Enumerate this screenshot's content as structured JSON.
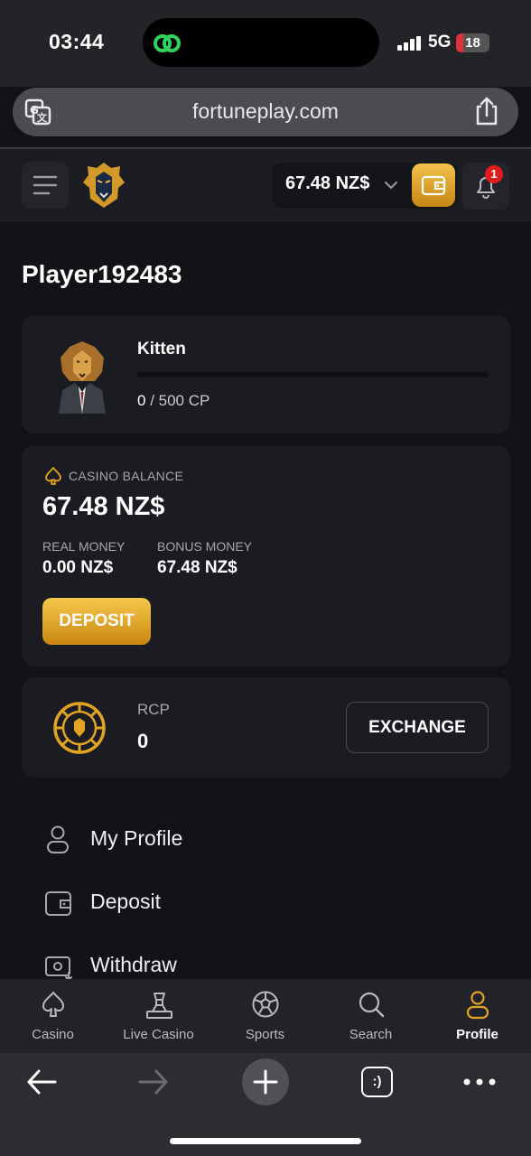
{
  "status_bar": {
    "time": "03:44",
    "network": "5G",
    "battery": "18"
  },
  "browser": {
    "url": "fortuneplay.com"
  },
  "header": {
    "balance": "67.48 NZ$",
    "notification_count": "1"
  },
  "profile": {
    "username": "Player192483",
    "level": {
      "name": "Kitten",
      "current_cp": "0",
      "progress_text": " / 500 CP"
    },
    "casino_balance": {
      "heading": "CASINO BALANCE",
      "amount": "67.48 NZ$",
      "real_money_label": "REAL MONEY",
      "real_money_value": "0.00 NZ$",
      "bonus_money_label": "BONUS MONEY",
      "bonus_money_value": "67.48 NZ$",
      "deposit_label": "DEPOSIT"
    },
    "rcp": {
      "label": "RCP",
      "value": "0",
      "exchange_label": "EXCHANGE"
    }
  },
  "menu": [
    {
      "label": "My Profile",
      "icon": "user-icon"
    },
    {
      "label": "Deposit",
      "icon": "wallet-icon"
    },
    {
      "label": "Withdraw",
      "icon": "withdraw-icon"
    }
  ],
  "bottom_nav": [
    {
      "label": "Casino",
      "icon": "spade-icon"
    },
    {
      "label": "Live Casino",
      "icon": "dealer-icon"
    },
    {
      "label": "Sports",
      "icon": "soccer-ball-icon"
    },
    {
      "label": "Search",
      "icon": "search-icon"
    },
    {
      "label": "Profile",
      "icon": "user-icon",
      "active": true
    }
  ],
  "colors": {
    "accent_gold": "#e3a322",
    "background": "#121317",
    "card": "#1b1c21",
    "badge_red": "#e21c1c"
  }
}
